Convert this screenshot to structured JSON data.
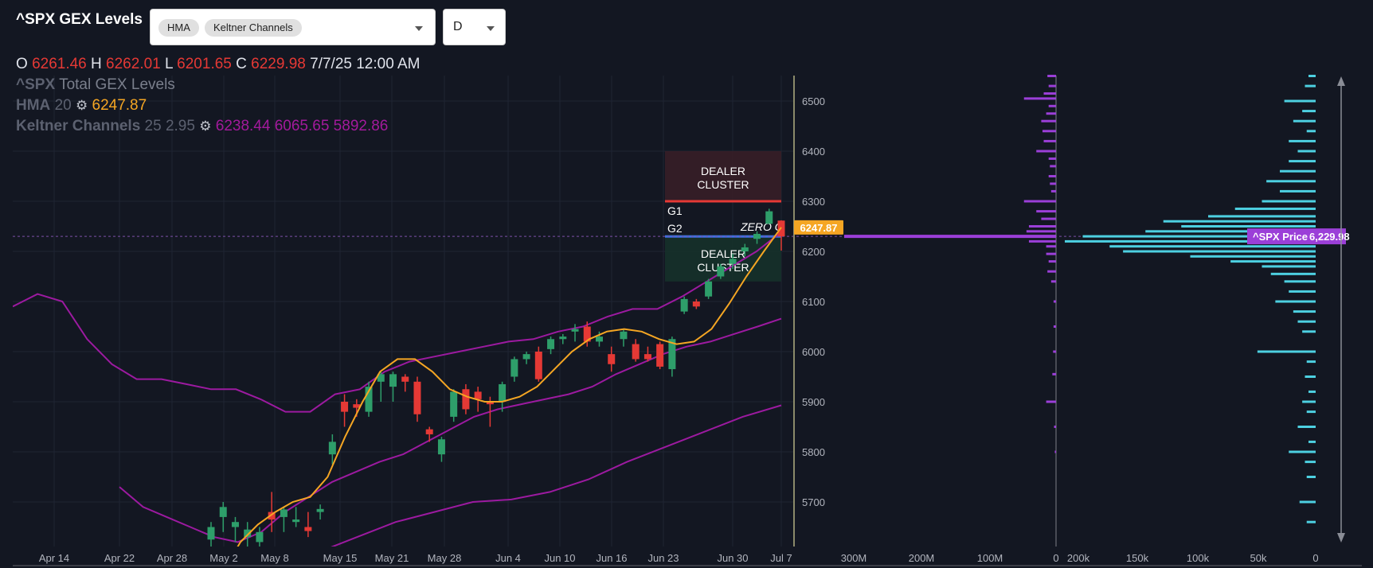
{
  "header": {
    "title": "^SPX GEX Levels",
    "indicator_chips": [
      "HMA",
      "Keltner Channels"
    ],
    "timeframe": "D"
  },
  "ohlc": {
    "o_label": "O",
    "o_value": "6261.46",
    "h_label": "H",
    "h_value": "6262.01",
    "l_label": "L",
    "l_value": "6201.65",
    "c_label": "C",
    "c_value": "6229.98",
    "datetime": "7/7/25 12:00 AM"
  },
  "legend": {
    "gex_symbol": "^SPX",
    "gex_name": "Total GEX Levels",
    "hma_name": "HMA",
    "hma_param": "20",
    "hma_value": "6247.87",
    "keltner_name": "Keltner Channels",
    "keltner_params": "25 2.95",
    "keltner_values": "6238.44 6065.65 5892.86"
  },
  "colors": {
    "background": "#131722",
    "up_candle": "#2e9e6a",
    "down_candle": "#e53935",
    "hma": "#f5a623",
    "keltner": "#9c1aa0",
    "gex_bars": "#9b3fd8",
    "volume_bars": "#4dd0e1",
    "price_badge": "#9b3fd8",
    "hma_badge": "#f5a623"
  },
  "annotations": {
    "dealer_cluster_top": "DEALER\nCLUSTER",
    "dealer_cluster_bottom": "DEALER\nCLUSTER",
    "g1": "G1",
    "g2": "G2",
    "zero_g": "ZERO G",
    "hma_badge": "6247.87",
    "price_badge": "^SPX Price",
    "price_badge_value": "6,229.98"
  },
  "icons": [
    "gear-icon",
    "chevron-down-icon",
    "scroll-arrow-icon"
  ],
  "chart_data": {
    "type": "candlestick",
    "y_ticks": [
      "6500",
      "6400",
      "6300",
      "6200",
      "6100",
      "6000",
      "5900",
      "5800",
      "5700"
    ],
    "x_ticks": [
      "Apr 14",
      "Apr 22",
      "Apr 28",
      "May 2",
      "May 8",
      "May 15",
      "May 21",
      "May 28",
      "Jun 4",
      "Jun 10",
      "Jun 16",
      "Jun 23",
      "Jun 30",
      "Jul 7"
    ],
    "gex_axis_ticks": [
      "300M",
      "200M",
      "100M",
      "0"
    ],
    "volume_axis_ticks": [
      "200k",
      "150k",
      "100k",
      "50k",
      "0"
    ],
    "ylim": [
      5640,
      6560
    ],
    "candles": [
      {
        "o": 5625,
        "h": 5660,
        "l": 5590,
        "c": 5650
      },
      {
        "o": 5670,
        "h": 5700,
        "l": 5640,
        "c": 5690
      },
      {
        "o": 5650,
        "h": 5670,
        "l": 5620,
        "c": 5660
      },
      {
        "o": 5630,
        "h": 5660,
        "l": 5600,
        "c": 5645
      },
      {
        "o": 5620,
        "h": 5650,
        "l": 5600,
        "c": 5640
      },
      {
        "o": 5680,
        "h": 5720,
        "l": 5640,
        "c": 5665
      },
      {
        "o": 5670,
        "h": 5690,
        "l": 5640,
        "c": 5685
      },
      {
        "o": 5660,
        "h": 5690,
        "l": 5650,
        "c": 5665
      },
      {
        "o": 5650,
        "h": 5680,
        "l": 5630,
        "c": 5642
      },
      {
        "o": 5680,
        "h": 5695,
        "l": 5665,
        "c": 5686
      },
      {
        "o": 5795,
        "h": 5835,
        "l": 5775,
        "c": 5820
      },
      {
        "o": 5900,
        "h": 5915,
        "l": 5850,
        "c": 5880
      },
      {
        "o": 5895,
        "h": 5905,
        "l": 5870,
        "c": 5888
      },
      {
        "o": 5880,
        "h": 5940,
        "l": 5870,
        "c": 5930
      },
      {
        "o": 5940,
        "h": 5960,
        "l": 5900,
        "c": 5955
      },
      {
        "o": 5930,
        "h": 5960,
        "l": 5900,
        "c": 5955
      },
      {
        "o": 5950,
        "h": 5955,
        "l": 5920,
        "c": 5940
      },
      {
        "o": 5940,
        "h": 5950,
        "l": 5860,
        "c": 5875
      },
      {
        "o": 5845,
        "h": 5850,
        "l": 5820,
        "c": 5835
      },
      {
        "o": 5795,
        "h": 5830,
        "l": 5780,
        "c": 5825
      },
      {
        "o": 5870,
        "h": 5925,
        "l": 5860,
        "c": 5920
      },
      {
        "o": 5925,
        "h": 5935,
        "l": 5875,
        "c": 5885
      },
      {
        "o": 5920,
        "h": 5930,
        "l": 5880,
        "c": 5905
      },
      {
        "o": 5900,
        "h": 5910,
        "l": 5850,
        "c": 5895
      },
      {
        "o": 5900,
        "h": 5940,
        "l": 5880,
        "c": 5935
      },
      {
        "o": 5950,
        "h": 5990,
        "l": 5940,
        "c": 5985
      },
      {
        "o": 5985,
        "h": 6000,
        "l": 5975,
        "c": 5995
      },
      {
        "o": 6000,
        "h": 6010,
        "l": 5940,
        "c": 5945
      },
      {
        "o": 6005,
        "h": 6030,
        "l": 5995,
        "c": 6025
      },
      {
        "o": 6025,
        "h": 6035,
        "l": 6015,
        "c": 6030
      },
      {
        "o": 6040,
        "h": 6055,
        "l": 6020,
        "c": 6045
      },
      {
        "o": 6050,
        "h": 6060,
        "l": 6010,
        "c": 6020
      },
      {
        "o": 6020,
        "h": 6040,
        "l": 6010,
        "c": 6030
      },
      {
        "o": 5995,
        "h": 6010,
        "l": 5960,
        "c": 5975
      },
      {
        "o": 6025,
        "h": 6045,
        "l": 6010,
        "c": 6040
      },
      {
        "o": 6015,
        "h": 6025,
        "l": 5980,
        "c": 5985
      },
      {
        "o": 5995,
        "h": 6010,
        "l": 5980,
        "c": 5985
      },
      {
        "o": 6015,
        "h": 6020,
        "l": 5965,
        "c": 5970
      },
      {
        "o": 5965,
        "h": 6030,
        "l": 5950,
        "c": 6025
      },
      {
        "o": 6080,
        "h": 6110,
        "l": 6075,
        "c": 6105
      },
      {
        "o": 6100,
        "h": 6105,
        "l": 6085,
        "c": 6090
      },
      {
        "o": 6110,
        "h": 6145,
        "l": 6105,
        "c": 6140
      },
      {
        "o": 6150,
        "h": 6175,
        "l": 6145,
        "c": 6170
      },
      {
        "o": 6175,
        "h": 6195,
        "l": 6165,
        "c": 6185
      },
      {
        "o": 6200,
        "h": 6215,
        "l": 6190,
        "c": 6208
      },
      {
        "o": 6225,
        "h": 6240,
        "l": 6215,
        "c": 6235
      },
      {
        "o": 6255,
        "h": 6285,
        "l": 6255,
        "c": 6280
      },
      {
        "o": 6261.46,
        "h": 6262.01,
        "l": 6201.65,
        "c": 6229.98
      }
    ],
    "hma": [
      5560,
      5620,
      5655,
      5680,
      5700,
      5710,
      5750,
      5830,
      5900,
      5960,
      5985,
      5985,
      5960,
      5925,
      5910,
      5900,
      5900,
      5910,
      5930,
      5965,
      6000,
      6025,
      6040,
      6045,
      6040,
      6025,
      6015,
      6020,
      6045,
      6095,
      6150,
      6200,
      6247.87
    ],
    "keltner_upper": [
      6090,
      6115,
      6100,
      6025,
      5975,
      5945,
      5945,
      5935,
      5925,
      5925,
      5905,
      5880,
      5880,
      5915,
      5925,
      5960,
      5980,
      5990,
      6000,
      6010,
      6020,
      6025,
      6040,
      6050,
      6070,
      6085,
      6085,
      6110,
      6140,
      6170,
      6200,
      6238.44
    ],
    "keltner_middle": [
      5730,
      5690,
      5670,
      5650,
      5630,
      5620,
      5640,
      5680,
      5710,
      5740,
      5760,
      5780,
      5795,
      5820,
      5845,
      5870,
      5885,
      5895,
      5905,
      5915,
      5930,
      5955,
      5975,
      5995,
      6010,
      6020,
      6035,
      6050,
      6065.65
    ],
    "keltner_lower": [
      5600,
      5630,
      5660,
      5680,
      5700,
      5705,
      5720,
      5745,
      5780,
      5810,
      5840,
      5870,
      5892.86
    ],
    "levels": {
      "g1": 6300,
      "g2": 6233,
      "zero_g": 6235,
      "dealer_cluster_top": [
        6300,
        6400
      ],
      "dealer_cluster_bottom": [
        6140,
        6233
      ],
      "price": 6229.98
    },
    "gex_profile": [
      {
        "p": 6550,
        "v": 35
      },
      {
        "p": 6530,
        "v": 30
      },
      {
        "p": 6515,
        "v": 50
      },
      {
        "p": 6505,
        "v": 130
      },
      {
        "p": 6490,
        "v": 30
      },
      {
        "p": 6475,
        "v": 40
      },
      {
        "p": 6460,
        "v": 60
      },
      {
        "p": 6440,
        "v": 55
      },
      {
        "p": 6420,
        "v": 50
      },
      {
        "p": 6400,
        "v": 80
      },
      {
        "p": 6385,
        "v": 30
      },
      {
        "p": 6370,
        "v": 25
      },
      {
        "p": 6350,
        "v": 30
      },
      {
        "p": 6335,
        "v": 25
      },
      {
        "p": 6320,
        "v": 20
      },
      {
        "p": 6300,
        "v": 130
      },
      {
        "p": 6280,
        "v": 80
      },
      {
        "p": 6265,
        "v": 60
      },
      {
        "p": 6250,
        "v": 110
      },
      {
        "p": 6240,
        "v": 120
      },
      {
        "p": 6230,
        "v": 420
      },
      {
        "p": 6220,
        "v": 110
      },
      {
        "p": 6210,
        "v": 40
      },
      {
        "p": 6195,
        "v": 40
      },
      {
        "p": 6180,
        "v": 30
      },
      {
        "p": 6160,
        "v": 35
      },
      {
        "p": 6140,
        "v": 20
      },
      {
        "p": 6100,
        "v": 10
      },
      {
        "p": 6050,
        "v": 10
      },
      {
        "p": 6000,
        "v": 12
      },
      {
        "p": 5955,
        "v": 15
      },
      {
        "p": 5900,
        "v": 40
      },
      {
        "p": 5850,
        "v": 8
      },
      {
        "p": 5800,
        "v": 5
      }
    ],
    "volume_profile": [
      {
        "p": 6550,
        "v": 8
      },
      {
        "p": 6530,
        "v": 12
      },
      {
        "p": 6500,
        "v": 35
      },
      {
        "p": 6480,
        "v": 15
      },
      {
        "p": 6460,
        "v": 25
      },
      {
        "p": 6440,
        "v": 10
      },
      {
        "p": 6420,
        "v": 30
      },
      {
        "p": 6400,
        "v": 20
      },
      {
        "p": 6380,
        "v": 30
      },
      {
        "p": 6360,
        "v": 40
      },
      {
        "p": 6340,
        "v": 55
      },
      {
        "p": 6320,
        "v": 40
      },
      {
        "p": 6300,
        "v": 60
      },
      {
        "p": 6285,
        "v": 90
      },
      {
        "p": 6270,
        "v": 120
      },
      {
        "p": 6260,
        "v": 170
      },
      {
        "p": 6250,
        "v": 150
      },
      {
        "p": 6240,
        "v": 190
      },
      {
        "p": 6230,
        "v": 260
      },
      {
        "p": 6220,
        "v": 280
      },
      {
        "p": 6210,
        "v": 230
      },
      {
        "p": 6200,
        "v": 215
      },
      {
        "p": 6190,
        "v": 140
      },
      {
        "p": 6180,
        "v": 95
      },
      {
        "p": 6170,
        "v": 60
      },
      {
        "p": 6155,
        "v": 50
      },
      {
        "p": 6140,
        "v": 35
      },
      {
        "p": 6120,
        "v": 30
      },
      {
        "p": 6100,
        "v": 45
      },
      {
        "p": 6080,
        "v": 25
      },
      {
        "p": 6060,
        "v": 20
      },
      {
        "p": 6040,
        "v": 15
      },
      {
        "p": 6000,
        "v": 65
      },
      {
        "p": 5980,
        "v": 10
      },
      {
        "p": 5950,
        "v": 12
      },
      {
        "p": 5920,
        "v": 8
      },
      {
        "p": 5900,
        "v": 15
      },
      {
        "p": 5880,
        "v": 10
      },
      {
        "p": 5850,
        "v": 20
      },
      {
        "p": 5820,
        "v": 8
      },
      {
        "p": 5800,
        "v": 30
      },
      {
        "p": 5780,
        "v": 12
      },
      {
        "p": 5750,
        "v": 10
      },
      {
        "p": 5700,
        "v": 18
      },
      {
        "p": 5660,
        "v": 10
      }
    ]
  }
}
